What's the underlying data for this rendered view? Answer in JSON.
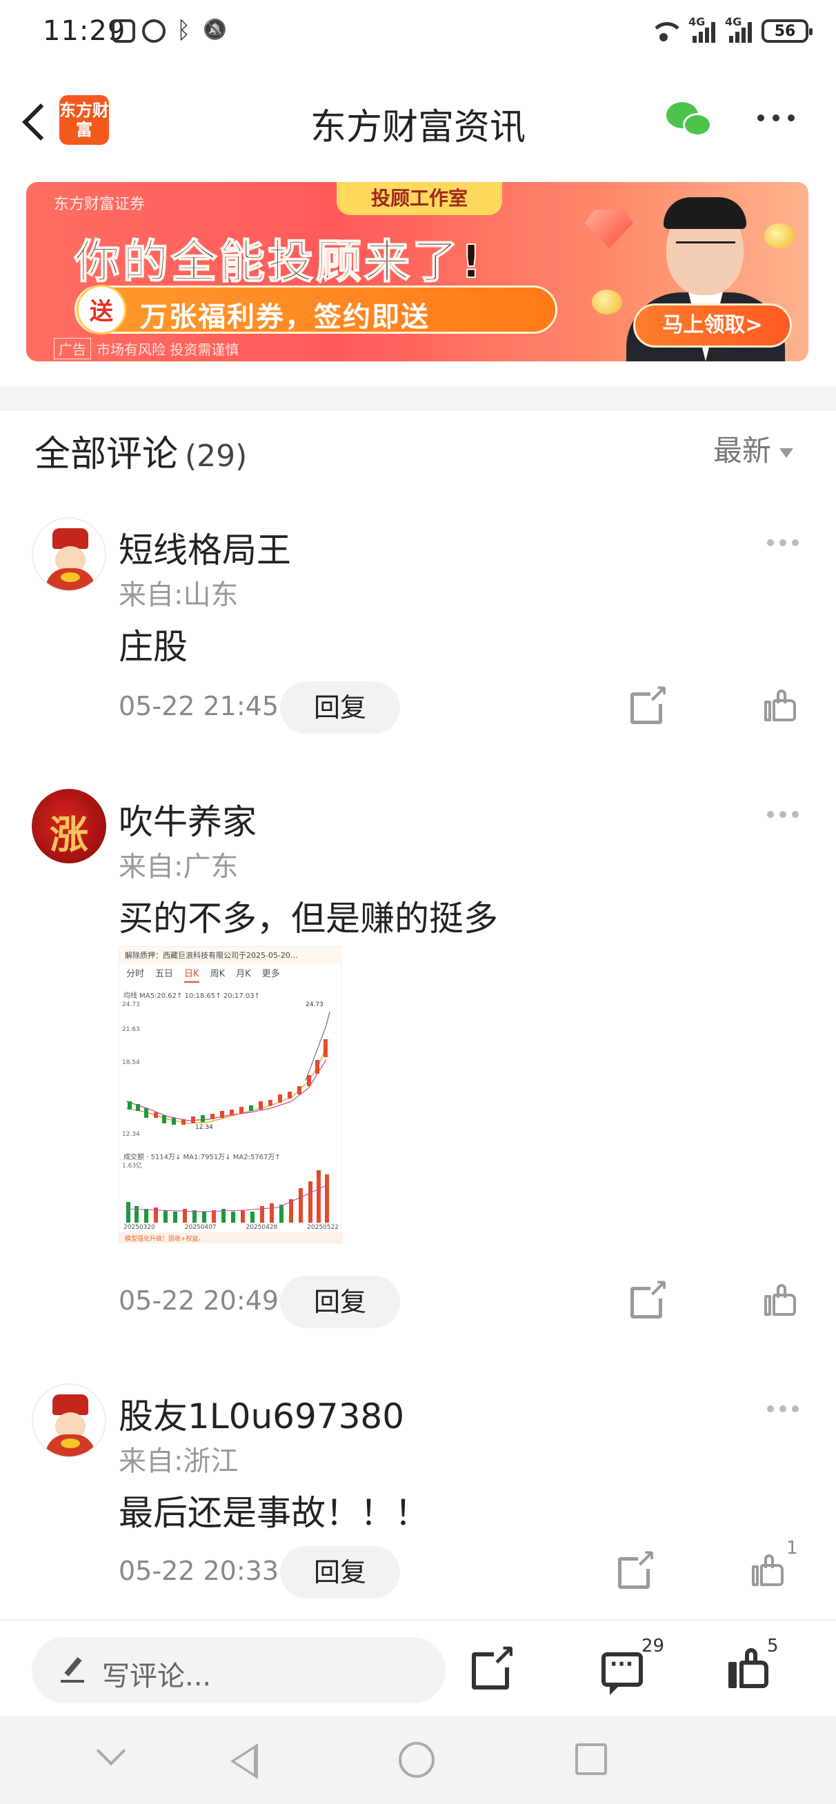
{
  "status_bar": {
    "time": "11:29",
    "battery": "56",
    "signal1_label": "4G",
    "signal2_label": "4G",
    "wifi_label": "6"
  },
  "header": {
    "logo_text": "东方财富",
    "title": "东方财富资讯"
  },
  "banner": {
    "brand": "东方财富证券",
    "tag": "投顾工作室",
    "headline": "你的全能投顾来了!",
    "sub_circle": "送",
    "sub_text": "万张福利券，签约即送",
    "cta": "马上领取>",
    "ad_label": "广告",
    "disclaimer": "市场有风险 投资需谨慎"
  },
  "comments_section": {
    "title": "全部评论",
    "count": "(29)",
    "sort": "最新"
  },
  "comments": [
    {
      "name": "短线格局王",
      "location": "来自:山东",
      "text": "庄股",
      "time": "05-22 21:45",
      "reply": "回复",
      "likes": ""
    },
    {
      "name": "吹牛养家",
      "location": "来自:广东",
      "text": "买的不多，但是赚的挺多",
      "time": "05-22 20:49",
      "reply": "回复",
      "likes": "",
      "avatar_char": "涨",
      "image": {
        "notice": "解除质押：西藏巨浪科技有限公司于2025-05-20…",
        "tabs": [
          "分时",
          "五日",
          "日K",
          "周K",
          "月K",
          "更多"
        ],
        "active_tab": "日K",
        "ma_line": "均线  MA5:20.62↑  10:18.65↑  20:17.03↑",
        "price_high": "24.73",
        "price_levels": [
          "24.73",
          "21.63",
          "18.54",
          "12.34"
        ],
        "low_label": "12.34",
        "vol_line": "成交额 · 5114万↓  MA1:7951万↓  MA2:5767万↑",
        "vol_max": "1.63亿",
        "dates": [
          "20250320",
          "20250407",
          "20250428",
          "20250522"
        ],
        "footer": "模型强化升级！固收+权益。"
      }
    },
    {
      "name": "股友1L0u697380",
      "location": "来自:浙江",
      "text": "最后还是事故！！！",
      "time": "05-22 20:33",
      "reply": "回复",
      "likes": "1"
    }
  ],
  "bottom_bar": {
    "input_placeholder": "写评论...",
    "comment_count": "29",
    "like_count": "5"
  },
  "colors": {
    "brand_orange": "#f25a1d",
    "wechat_green": "#4cc34b",
    "stock_up": "#e24b2b",
    "stock_down": "#1a9a3a"
  }
}
